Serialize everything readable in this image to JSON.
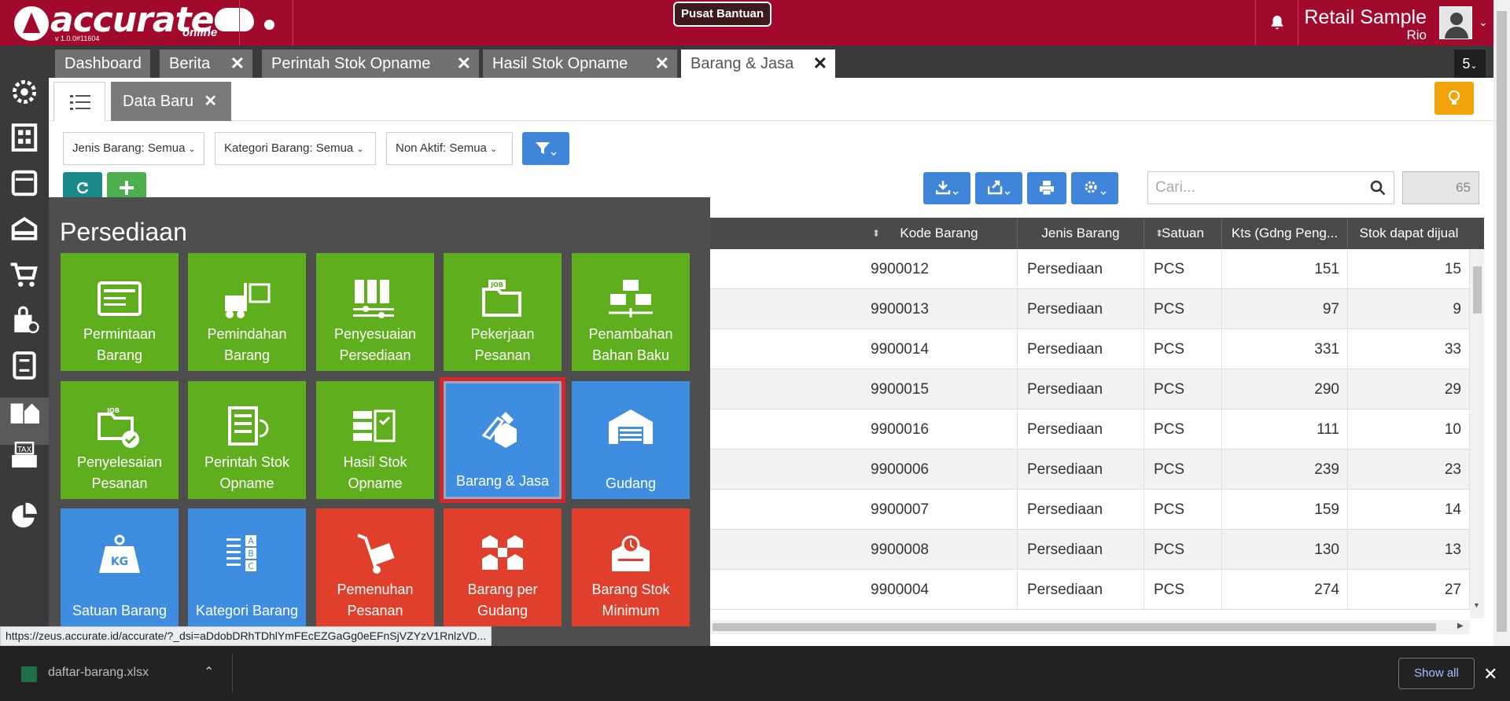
{
  "app": {
    "logo_text": "accurate",
    "logo_sub": "online",
    "version": "v 1.0.0#11604",
    "help_button": "Pusat Bantuan",
    "company": "Retail Sample",
    "user": "Rio"
  },
  "tabs": [
    {
      "label": "Dashboard",
      "closable": false
    },
    {
      "label": "Berita",
      "closable": true
    },
    {
      "label": "Perintah Stok Opname",
      "closable": true
    },
    {
      "label": "Hasil Stok Opname",
      "closable": true
    },
    {
      "label": "Barang & Jasa",
      "closable": true,
      "active": true
    }
  ],
  "tab_count": "5",
  "subtabs": {
    "new_label": "Data Baru"
  },
  "filters": [
    {
      "label": "Jenis Barang: Semua"
    },
    {
      "label": "Kategori Barang: Semua"
    },
    {
      "label": "Non Aktif: Semua"
    }
  ],
  "search": {
    "placeholder": "Cari..."
  },
  "record_count": "65",
  "table": {
    "columns": [
      "Kode Barang",
      "Jenis Barang",
      "Satuan",
      "Kts (Gdng Peng...",
      "Stok dapat dijual"
    ],
    "rows": [
      {
        "kode": "9900012",
        "jenis": "Persediaan",
        "satuan": "PCS",
        "kts": "151",
        "stok": "15"
      },
      {
        "kode": "9900013",
        "jenis": "Persediaan",
        "satuan": "PCS",
        "kts": "97",
        "stok": "9"
      },
      {
        "kode": "9900014",
        "jenis": "Persediaan",
        "satuan": "PCS",
        "kts": "331",
        "stok": "33"
      },
      {
        "kode": "9900015",
        "jenis": "Persediaan",
        "satuan": "PCS",
        "kts": "290",
        "stok": "29"
      },
      {
        "kode": "9900016",
        "jenis": "Persediaan",
        "satuan": "PCS",
        "kts": "111",
        "stok": "10"
      },
      {
        "kode": "9900006",
        "jenis": "Persediaan",
        "satuan": "PCS",
        "kts": "239",
        "stok": "23"
      },
      {
        "kode": "9900007",
        "jenis": "Persediaan",
        "satuan": "PCS",
        "kts": "159",
        "stok": "14"
      },
      {
        "kode": "9900008",
        "jenis": "Persediaan",
        "satuan": "PCS",
        "kts": "130",
        "stok": "13"
      },
      {
        "kode": "9900004",
        "jenis": "Persediaan",
        "satuan": "PCS",
        "kts": "274",
        "stok": "27"
      }
    ]
  },
  "menu": {
    "title": "Persediaan",
    "tiles": [
      {
        "line1": "Permintaan",
        "line2": "Barang",
        "color": "green",
        "icon": "request-form-icon"
      },
      {
        "line1": "Pemindahan",
        "line2": "Barang",
        "color": "green",
        "icon": "forklift-icon"
      },
      {
        "line1": "Penyesuaian",
        "line2": "Persediaan",
        "color": "green",
        "icon": "adjust-icon"
      },
      {
        "line1": "Pekerjaan",
        "line2": "Pesanan",
        "color": "green",
        "icon": "job-folder-icon"
      },
      {
        "line1": "Penambahan",
        "line2": "Bahan Baku",
        "color": "green",
        "icon": "boxes-icon"
      },
      {
        "line1": "Penyelesaian",
        "line2": "Pesanan",
        "color": "green",
        "icon": "job-done-icon"
      },
      {
        "line1": "Perintah Stok",
        "line2": "Opname",
        "color": "green",
        "icon": "stock-order-icon"
      },
      {
        "line1": "Hasil Stok",
        "line2": "Opname",
        "color": "green",
        "icon": "stock-result-icon"
      },
      {
        "line1": "",
        "line2": "Barang & Jasa",
        "color": "blue",
        "icon": "goods-services-icon",
        "selected": true
      },
      {
        "line1": "",
        "line2": "Gudang",
        "color": "blue",
        "icon": "warehouse-icon"
      },
      {
        "line1": "",
        "line2": "Satuan Barang",
        "color": "blue",
        "icon": "weight-kg-icon"
      },
      {
        "line1": "",
        "line2": "Kategori Barang",
        "color": "blue",
        "icon": "abc-list-icon"
      },
      {
        "line1": "Pemenuhan",
        "line2": "Pesanan",
        "color": "red",
        "icon": "hand-truck-icon"
      },
      {
        "line1": "Barang per",
        "line2": "Gudang",
        "color": "red",
        "icon": "warehouses-icon"
      },
      {
        "line1": "Barang Stok",
        "line2": "Minimum",
        "color": "red",
        "icon": "min-stock-icon"
      }
    ],
    "icon_text": {
      "kg": "KG",
      "abc_a": "A",
      "abc_b": "B",
      "abc_c": "C",
      "job": "JOB",
      "tax": "TAX"
    }
  },
  "status_url": "https://zeus.accurate.id/accurate/?_dsi=aDdobDRhTDhlYmFEcEZGaGg0eEFnSjVZYzV1RnlzVD...",
  "download": {
    "file": "daftar-barang.xlsx",
    "show_all": "Show all"
  },
  "colors": {
    "brand": "#a10a2d",
    "green_tile": "#5fae1e",
    "blue_tile": "#3f8de0",
    "red_tile": "#e0402b"
  }
}
